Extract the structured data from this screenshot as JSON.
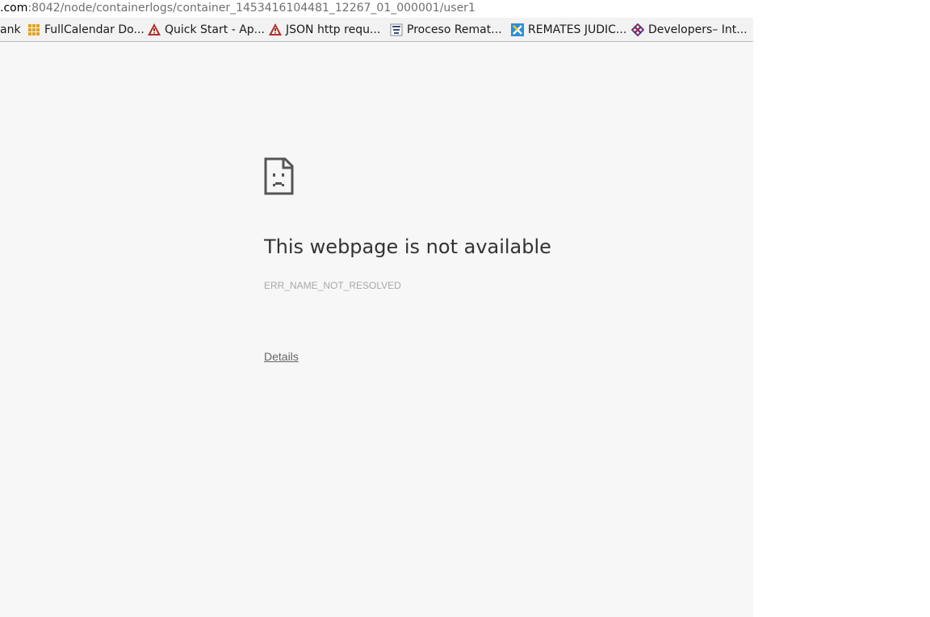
{
  "address_bar": {
    "host_suffix": ".com",
    "path": ":8042/node/containerlogs/container_1453416104481_12267_01_000001/user1"
  },
  "bookmarks": [
    {
      "label": "ank",
      "icon": "none"
    },
    {
      "label": "FullCalendar Do...",
      "icon": "grid-icon"
    },
    {
      "label": "Quick Start - Ap...",
      "icon": "warning-triangle-icon"
    },
    {
      "label": "JSON http requ...",
      "icon": "warning-triangle-icon"
    },
    {
      "label": "Proceso Remat...",
      "icon": "document-stack-icon"
    },
    {
      "label": "REMATES JUDIC...",
      "icon": "x-square-icon"
    },
    {
      "label": "Developers– Int...",
      "icon": "knot-icon"
    }
  ],
  "error_page": {
    "icon": "sad-page-icon",
    "title": "This webpage is not available",
    "error_code": "ERR_NAME_NOT_RESOLVED",
    "details_link": "Details"
  },
  "colors": {
    "page_background": "#f7f7f7",
    "title_text": "#333333",
    "error_code_text": "#a8a8a8",
    "link_text": "#656565"
  }
}
